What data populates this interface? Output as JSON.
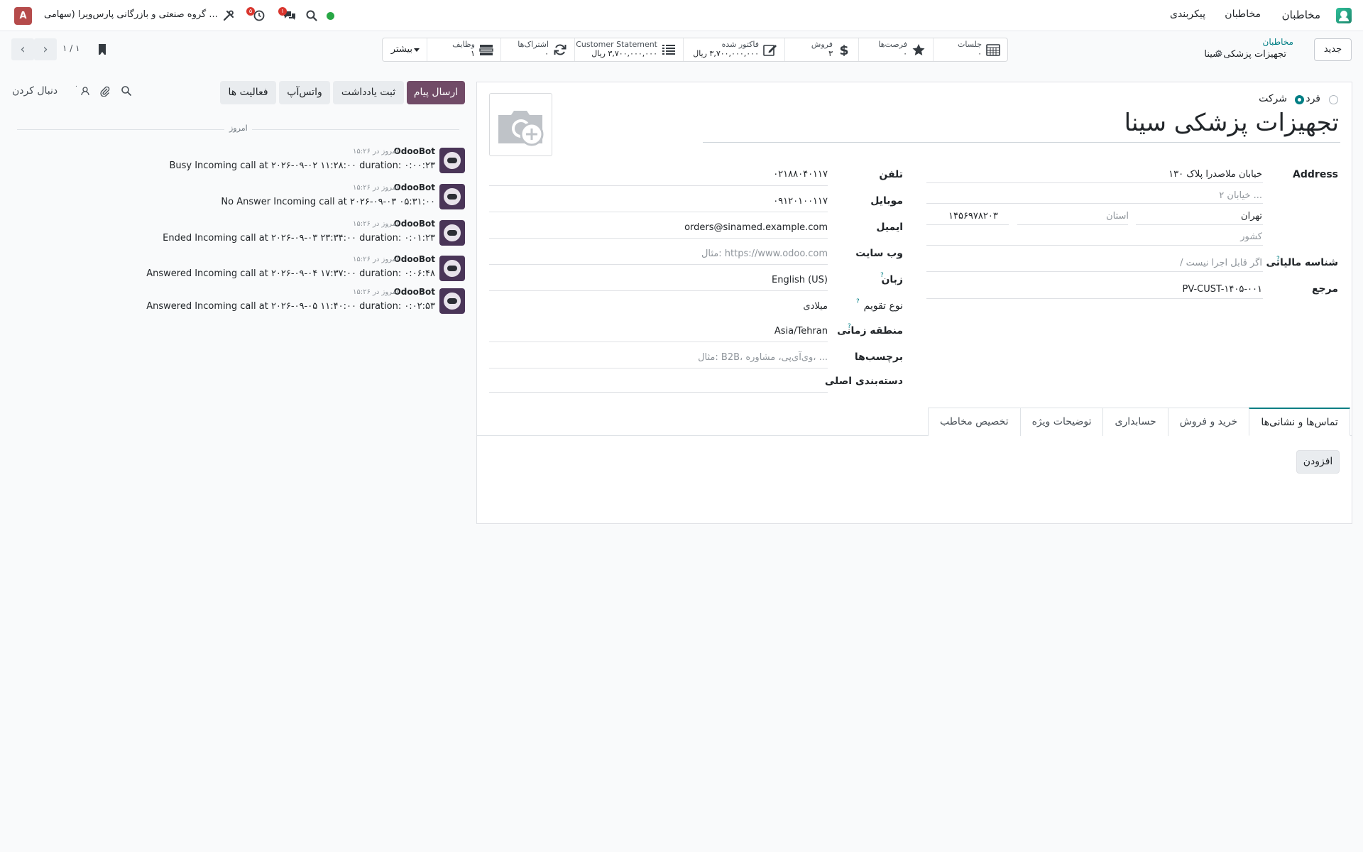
{
  "navbar": {
    "app_name": "مخاطبان",
    "menu": [
      "مخاطبان",
      "پیکربندی"
    ],
    "company": "گروه صنعتی و بازرگانی پارس‌ویرا (سهامی ...",
    "user_initial": "A",
    "activity_badge": "۵",
    "messages_badge": "۱",
    "status_color": "#28a745"
  },
  "control": {
    "new_button": "جدید",
    "breadcrumb_parent": "مخاطبان",
    "breadcrumb_current": "تجهیزات پزشکی سینا",
    "pager": "۱ / ۱",
    "more_label": "بیشتر",
    "smart_buttons": [
      {
        "label": "جلسات",
        "value": "۰",
        "icon": "calendar-icon"
      },
      {
        "label": "فرصت‌ها",
        "value": "۰",
        "icon": "star-icon"
      },
      {
        "label": "فروش",
        "value": "۳",
        "icon": "dollar-icon"
      },
      {
        "label": "فاکتور شده",
        "value": "۳,۷۰۰,۰۰۰,۰۰۰ ریال",
        "icon": "edit-icon"
      },
      {
        "label": "Customer Statement",
        "value": "۳,۷۰۰,۰۰۰,۰۰۰ ریال",
        "icon": "list-icon"
      },
      {
        "label": "اشتراک‌ها",
        "value": "۰",
        "icon": "refresh-icon"
      },
      {
        "label": "وظایف",
        "value": "۱",
        "icon": "tasks-icon"
      }
    ]
  },
  "form": {
    "type_person": "فرد",
    "type_company": "شرکت",
    "selected_type": "company",
    "name": "تجهیزات پزشکی سینا",
    "address_label": "Address",
    "street": "خیابان ملاصدرا پلاک ۱۳۰",
    "street2_placeholder": "خیابان ۲ ...",
    "city": "تهران",
    "state_placeholder": "استان",
    "zip": "۱۴۵۶۹۷۸۲۰۳",
    "country_placeholder": "کشور",
    "vat_label": "شناسه مالیاتی",
    "vat_placeholder": "/ اگر قابل اجرا نیست",
    "ref_label": "مرجع",
    "ref_value": "PV-CUST-۱۴۰۵-۰۰۱",
    "phone_label": "تلفن",
    "phone": "۰۲۱۸۸۰۴۰۱۱۷",
    "mobile_label": "موبایل",
    "mobile": "۰۹۱۲۰۱۰۰۱۱۷",
    "email_label": "ایمیل",
    "email": "orders@sinamed.example.com",
    "website_label": "وب سایت",
    "website_placeholder": "مثال: https://www.odoo.com",
    "lang_label": "زبان",
    "lang": "English (US)",
    "calendar_label": "نوع تقویم",
    "calendar": "میلادی",
    "tz_label": "منطقه زمانی",
    "tz": "Asia/Tehran",
    "tags_label": "برچسب‌ها",
    "tags_placeholder": "مثال: B2B، وی‌آی‌پی، مشاوره، ...",
    "category_label": "دسته‌بندی اصلی",
    "tabs": [
      "تماس‌ها و نشانی‌ها",
      "خرید و فروش",
      "حسابداری",
      "توضیحات ویژه",
      "تخصیص مخاطب"
    ],
    "add_button": "افزودن"
  },
  "chatter": {
    "send_message": "ارسال پیام",
    "log_note": "ثبت یادداشت",
    "whatsapp": "واتس‌آپ",
    "activities": "فعالیت ها",
    "follow": "دنبال کردن",
    "followers_count": "۰",
    "today": "امروز",
    "messages": [
      {
        "author": "OdooBot",
        "time": "امروز در ۱۵:۲۶",
        "body": "Busy Incoming call at ۲۰۲۶-۰۹-۰۲ ۱۱:۲۸:۰۰ duration: ۰:۰۰:۲۳"
      },
      {
        "author": "OdooBot",
        "time": "امروز در ۱۵:۲۶",
        "body": "No Answer Incoming call at ۲۰۲۶-۰۹-۰۳ ۰۵:۳۱:۰۰"
      },
      {
        "author": "OdooBot",
        "time": "امروز در ۱۵:۲۶",
        "body": "Ended Incoming call at ۲۰۲۶-۰۹-۰۳ ۲۳:۳۴:۰۰ duration: ۰:۰۱:۲۳"
      },
      {
        "author": "OdooBot",
        "time": "امروز در ۱۵:۲۶",
        "body": "Answered Incoming call at ۲۰۲۶-۰۹-۰۴ ۱۷:۳۷:۰۰ duration: ۰:۰۶:۴۸"
      },
      {
        "author": "OdooBot",
        "time": "امروز در ۱۵:۲۶",
        "body": "Answered Incoming call at ۲۰۲۶-۰۹-۰۵ ۱۱:۴۰:۰۰ duration: ۰:۰۲:۵۳"
      }
    ]
  }
}
